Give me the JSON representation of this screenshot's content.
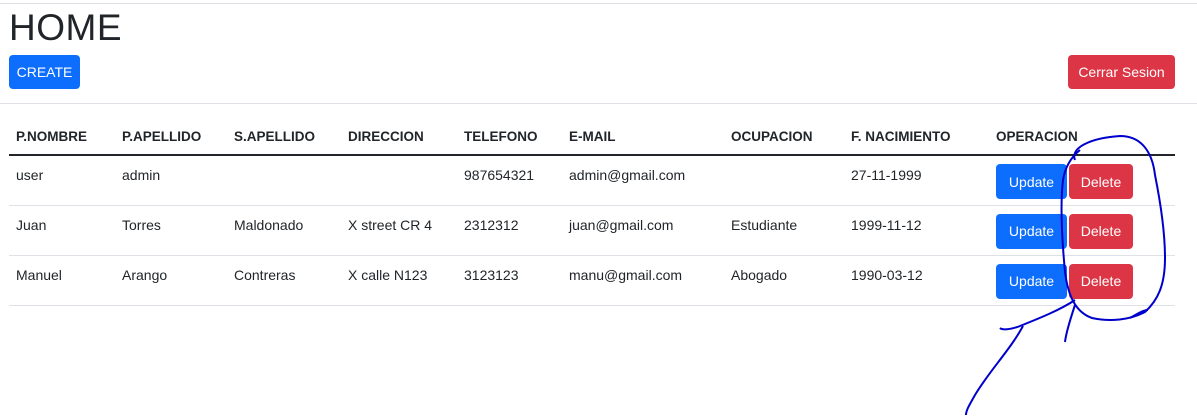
{
  "page": {
    "title": "HOME"
  },
  "toolbar": {
    "create_label": "CREATE",
    "logout_label": "Cerrar Sesion"
  },
  "table": {
    "headers": [
      "P.NOMBRE",
      "P.APELLIDO",
      "S.APELLIDO",
      "DIRECCION",
      "TELEFONO",
      "E-MAIL",
      "OCUPACION",
      "F. NACIMIENTO",
      "OPERACION"
    ],
    "rows": [
      {
        "nombre": "user",
        "apellido1": "admin",
        "apellido2": "",
        "direccion": "",
        "telefono": "987654321",
        "email": "admin@gmail.com",
        "ocupacion": "",
        "nacimiento": "27-11-1999",
        "update": "Update",
        "delete": "Delete"
      },
      {
        "nombre": "Juan",
        "apellido1": "Torres",
        "apellido2": "Maldonado",
        "direccion": "X street CR 4",
        "telefono": "2312312",
        "email": "juan@gmail.com",
        "ocupacion": "Estudiante",
        "nacimiento": "1999-11-12",
        "update": "Update",
        "delete": "Delete"
      },
      {
        "nombre": "Manuel",
        "apellido1": "Arango",
        "apellido2": "Contreras",
        "direccion": "X calle N123",
        "telefono": "3123123",
        "email": "manu@gmail.com",
        "ocupacion": "Abogado",
        "nacimiento": "1990-03-12",
        "update": "Update",
        "delete": "Delete"
      }
    ]
  },
  "colors": {
    "primary": "#0d6efd",
    "danger": "#dc3545",
    "annotation": "#0000cc"
  }
}
